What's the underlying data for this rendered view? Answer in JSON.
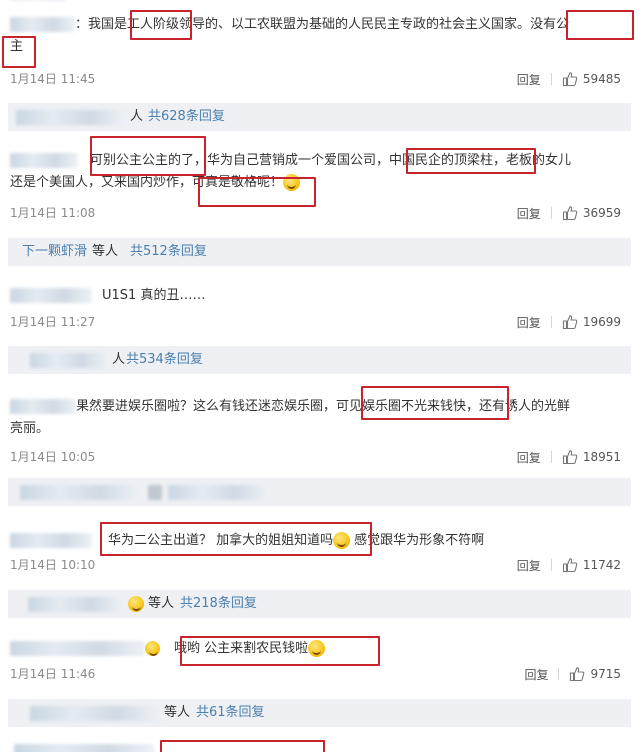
{
  "comments": [
    {
      "prefix": "：",
      "text_a": "我国是",
      "hl1": "工人阶级",
      "text_b": "领导的、以工农联盟为基础的人民民主专政的社会主义国家。",
      "hl2_a": "没有公",
      "hl2_b": "主",
      "time": "1月14日 11:45",
      "reply": "回复",
      "likes": "59485"
    },
    {
      "text_a": "可别公主公主的了",
      "text_b": "，华为自己营销成一个爱国公司",
      "hl1": "，中国民企的顶梁柱，",
      "text_c": "老板的女儿",
      "line2_a": "还是个美国人，又来国内炒作，",
      "hl2": "可真是敬格呢！",
      "time": "1月14日 11:08",
      "reply": "回复",
      "likes": "36959"
    },
    {
      "text": "U1S1 真的丑……",
      "time": "1月14日 11:27",
      "reply": "回复",
      "likes": "19699"
    },
    {
      "text_a": "果然要进娱乐圈啦？这么有钱还迷恋娱乐圈，",
      "hl1": "可见娱乐圈不光来钱快，",
      "text_b": "还有诱人的光鲜",
      "line2": "亮丽。",
      "time": "1月14日 10:05",
      "reply": "回复",
      "likes": "18951"
    },
    {
      "hl1": "华为二公主出道？ 加拿大的姐姐知道吗",
      "text_b": "感觉跟华为形象不符啊",
      "time": "1月14日 10:10",
      "reply": "回复",
      "likes": "11742"
    },
    {
      "hl1": "哦哟 公主来割农民钱啦",
      "time": "1月14日 11:46",
      "reply": "回复",
      "likes": "9715"
    }
  ],
  "sub_replies": [
    {
      "who": "人",
      "count": "共628条回复"
    },
    {
      "name": "下一颗虾滑",
      "who": " 等人",
      "count": "共512条回复"
    },
    {
      "who": "人",
      "count": "共534条回复"
    },
    {
      "who": "",
      "count": ""
    },
    {
      "who": "等人",
      "count": "共218条回复"
    },
    {
      "who": "等人",
      "count": "共61条回复"
    }
  ],
  "colors": {
    "highlight_box": "#c8232c",
    "link": "#4b7fae",
    "sub_bg": "#eef0f3"
  },
  "icons": {
    "like": "thumbs-up-icon",
    "emoji": "smile-emoji-icon"
  }
}
